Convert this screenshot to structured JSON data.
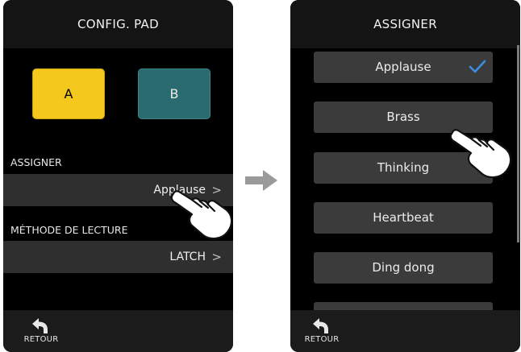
{
  "left_screen": {
    "title": "CONFIG. PAD",
    "pads": {
      "a": "A",
      "b": "B"
    },
    "assigner_label": "ASSIGNER",
    "assigner_value": "Applause",
    "method_label": "MÉTHODE DE LECTURE",
    "method_value": "LATCH",
    "chevron": ">",
    "back_label": "RETOUR"
  },
  "right_screen": {
    "title": "ASSIGNER",
    "items": [
      "Applause",
      "Brass",
      "Thinking",
      "Heartbeat",
      "Ding dong"
    ],
    "selected": "Applause",
    "back_label": "RETOUR"
  },
  "colors": {
    "pad_a": "#f5c81e",
    "pad_b": "#2a6b6f",
    "checkmark": "#3b8ede",
    "background": "#000000"
  },
  "icons": [
    "back-arrow-icon",
    "checkmark-icon",
    "chevron-right-icon",
    "pointing-hand-icon",
    "right-arrow-icon"
  ]
}
